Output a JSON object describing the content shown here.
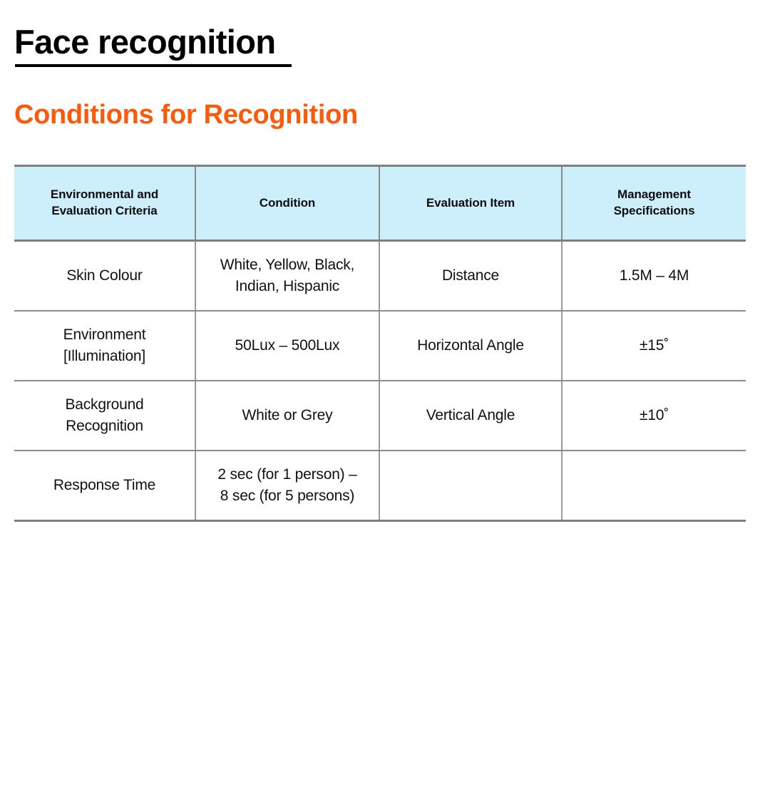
{
  "slide": {
    "title": "Face recognition",
    "subtitle": "Conditions for Recognition",
    "accent_color": "#fa5a0a",
    "header_fill": "#cdeefb",
    "title_color": "#000000"
  },
  "table": {
    "headers": [
      {
        "line1": "Environmental and",
        "line2": "Evaluation Criteria"
      },
      {
        "line1": "Condition",
        "line2": ""
      },
      {
        "line1": "Evaluation Item",
        "line2": ""
      },
      {
        "line1": "Management",
        "line2": "Specifications"
      }
    ],
    "rows": [
      {
        "criteria": {
          "line1": "Skin Colour",
          "line2": ""
        },
        "condition": {
          "line1": "White, Yellow, Black,",
          "line2": "Indian, Hispanic"
        },
        "evaluation_item": {
          "line1": "Distance",
          "line2": ""
        },
        "management_spec": {
          "line1": "1.5M – 4M",
          "line2": ""
        }
      },
      {
        "criteria": {
          "line1": "Environment",
          "line2": "[Illumination]"
        },
        "condition": {
          "line1": "50Lux – 500Lux",
          "line2": ""
        },
        "evaluation_item": {
          "line1": "Horizontal Angle",
          "line2": ""
        },
        "management_spec": {
          "line1": "±15˚",
          "line2": ""
        }
      },
      {
        "criteria": {
          "line1": "Background",
          "line2": "Recognition"
        },
        "condition": {
          "line1": "White or Grey",
          "line2": ""
        },
        "evaluation_item": {
          "line1": "Vertical Angle",
          "line2": ""
        },
        "management_spec": {
          "line1": "±10˚",
          "line2": ""
        }
      },
      {
        "criteria": {
          "line1": "Response Time",
          "line2": ""
        },
        "condition": {
          "line1": "2 sec (for 1 person) –",
          "line2": "8 sec (for 5 persons)"
        },
        "evaluation_item": {
          "line1": "",
          "line2": ""
        },
        "management_spec": {
          "line1": "",
          "line2": ""
        }
      }
    ]
  }
}
